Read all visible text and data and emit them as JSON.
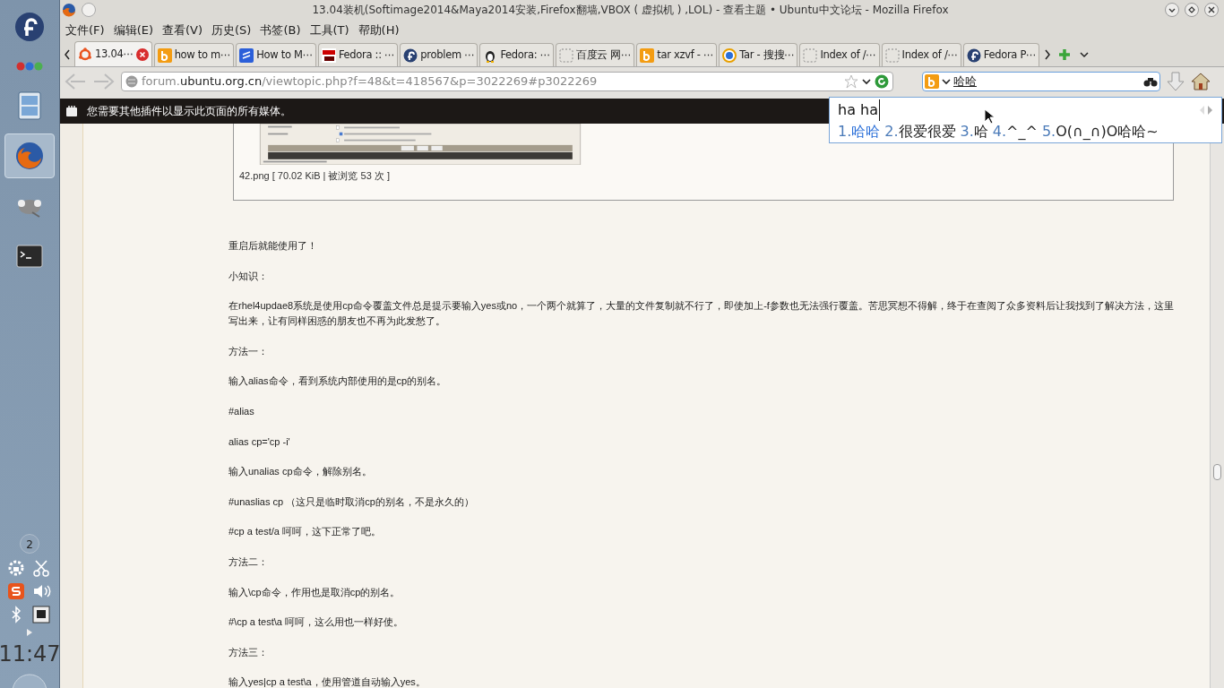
{
  "dock": {
    "launchers": [
      {
        "kind": "fedora",
        "selected": false
      },
      {
        "kind": "dots",
        "selected": false
      },
      {
        "kind": "files",
        "selected": false
      },
      {
        "kind": "firefox",
        "selected": true
      },
      {
        "kind": "gimp",
        "selected": false
      },
      {
        "kind": "terminal",
        "selected": false
      }
    ],
    "workspace": "2",
    "clock": "11:47"
  },
  "window": {
    "title": "13.04装机(Softimage2014&Maya2014安装,Firefox翻墙,VBOX ( 虚拟机 ) ,LOL) - 查看主题 • Ubuntu中文论坛 - Mozilla Firefox"
  },
  "menu": [
    "文件(F)",
    "编辑(E)",
    "查看(V)",
    "历史(S)",
    "书签(B)",
    "工具(T)",
    "帮助(H)"
  ],
  "tabs": [
    {
      "label": "13.04⋯",
      "kind": "ubuntu",
      "selected": true
    },
    {
      "label": "how to m⋯",
      "kind": "bing",
      "selected": false
    },
    {
      "label": "How to M⋯",
      "kind": "stack",
      "selected": false
    },
    {
      "label": "Fedora :: ⋯",
      "kind": "bigres",
      "selected": false
    },
    {
      "label": "problem ⋯",
      "kind": "fedora",
      "selected": false
    },
    {
      "label": "Fedora: ⋯",
      "kind": "tux",
      "selected": false
    },
    {
      "label": "百度云 网⋯",
      "kind": "blank",
      "selected": false
    },
    {
      "label": "tar xzvf - ⋯",
      "kind": "bing",
      "selected": false
    },
    {
      "label": "Tar - 搜搜⋯",
      "kind": "sogou",
      "selected": false
    },
    {
      "label": "Index of /⋯",
      "kind": "blank",
      "selected": false
    },
    {
      "label": "Index of /⋯",
      "kind": "blank",
      "selected": false
    },
    {
      "label": "Fedora P⋯",
      "kind": "fedora",
      "selected": false
    }
  ],
  "address": {
    "host_before": "forum.",
    "host": "ubuntu.org.cn",
    "path": "/viewtopic.php?f=48&t=418567&p=3022269#p3022269"
  },
  "search": {
    "value": "哈哈"
  },
  "plugin_bar": {
    "message": "您需要其他插件以显示此页面的所有媒体。"
  },
  "ime": {
    "input": "ha ha",
    "candidates": [
      {
        "index": "1.",
        "text": "哈哈",
        "selected": true
      },
      {
        "index": "2.",
        "text": "很爱很爱",
        "selected": false
      },
      {
        "index": "3.",
        "text": "哈",
        "selected": false
      },
      {
        "index": "4.",
        "text": "^_^",
        "selected": false
      },
      {
        "index": "5.",
        "text": "O(∩_∩)O哈哈~",
        "selected": false
      }
    ]
  },
  "attachment": {
    "caption": "42.png [ 70.02 KiB | 被浏览 53 次 ]"
  },
  "post": [
    "重启后就能使用了！",
    "小知识：",
    "在rhel4updae8系统是使用cp命令覆盖文件总是提示要输入yes或no，一个两个就算了，大量的文件复制就不行了，即使加上-f参数也无法强行覆盖。苦思冥想不得解，终于在查阅了众多资料后让我找到了解决方法，这里写出来，让有同样困惑的朋友也不再为此发愁了。",
    "方法一：",
    "输入alias命令，看到系统内部使用的是cp的别名。",
    "#alias",
    "alias cp='cp -i'",
    "输入unalias cp命令，解除别名。",
    "#unaslias cp （这只是临时取消cp的别名，不是永久的）",
    "#cp a test/a 呵呵，这下正常了吧。",
    "方法二：",
    "输入\\cp命令，作用也是取消cp的别名。",
    "#\\cp a test\\a 呵呵，这么用也一样好使。",
    "方法三：",
    "输入yes|cp a test\\a，使用管道自动输入yes。"
  ]
}
